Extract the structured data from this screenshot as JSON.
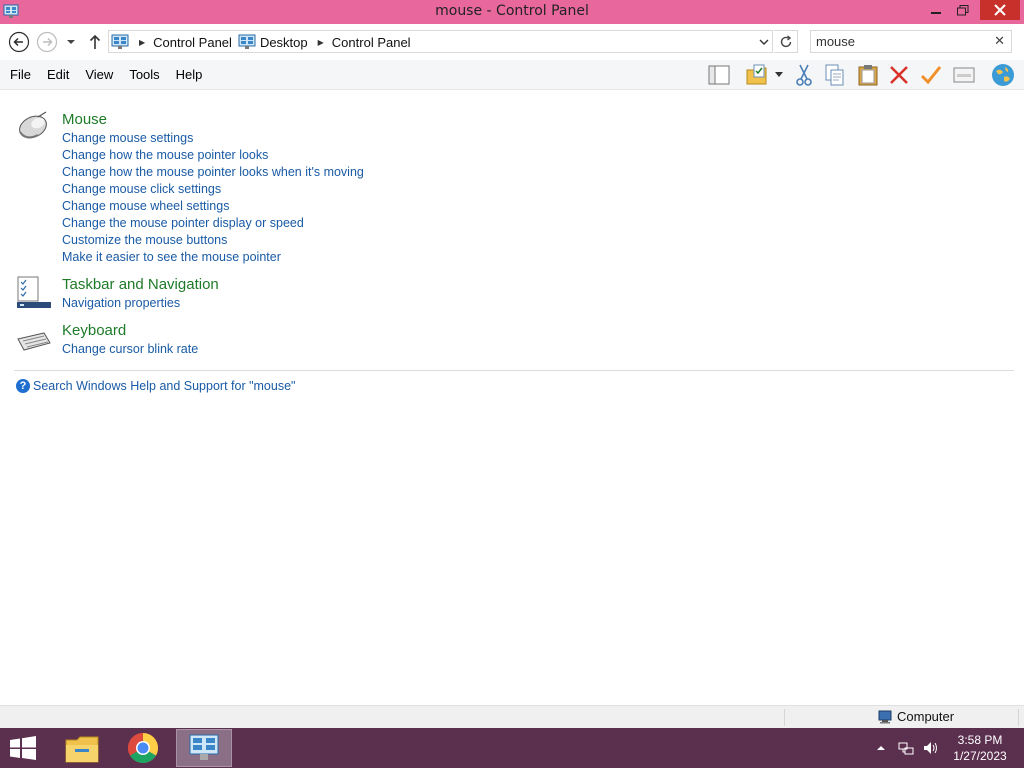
{
  "window": {
    "title": "mouse - Control Panel",
    "app_icon": "control-panel-icon",
    "buttons": {
      "minimize": "minimize-icon",
      "maximize": "restore-icon",
      "close": "close-icon"
    }
  },
  "address": {
    "breadcrumbs": [
      "Control Panel",
      "Desktop",
      "Control Panel"
    ],
    "search_value": "mouse"
  },
  "menu": [
    "File",
    "Edit",
    "View",
    "Tools",
    "Help"
  ],
  "toolbar_icons": [
    "layout-icon",
    "folder-options-icon",
    "dropdown-arrow-icon",
    "cut-icon",
    "copy-icon",
    "paste-icon",
    "delete-icon",
    "checkmark-icon",
    "properties-icon",
    "globe-icon"
  ],
  "results": [
    {
      "title": "Mouse",
      "icon": "mouse-icon",
      "links": [
        "Change mouse settings",
        "Change how the mouse pointer looks",
        "Change how the mouse pointer looks when it's moving",
        "Change mouse click settings",
        "Change mouse wheel settings",
        "Change the mouse pointer display or speed",
        "Customize the mouse buttons",
        "Make it easier to see the mouse pointer"
      ]
    },
    {
      "title": "Taskbar and Navigation",
      "icon": "taskbar-icon",
      "links": [
        "Navigation properties"
      ]
    },
    {
      "title": "Keyboard",
      "icon": "keyboard-icon",
      "links": [
        "Change cursor blink rate"
      ]
    }
  ],
  "help_link": "Search Windows Help and Support for \"mouse\"",
  "status": {
    "location": "Computer"
  },
  "taskbar": {
    "apps": [
      "file-explorer-icon",
      "chrome-icon",
      "control-panel-icon"
    ],
    "time": "3:58 PM",
    "date": "1/27/2023"
  },
  "colors": {
    "titlebar": "#e8679d",
    "close_button": "#c7302b",
    "group_title": "#1e7b28",
    "link": "#1a5ba6",
    "taskbar": "#5b2f4e"
  }
}
